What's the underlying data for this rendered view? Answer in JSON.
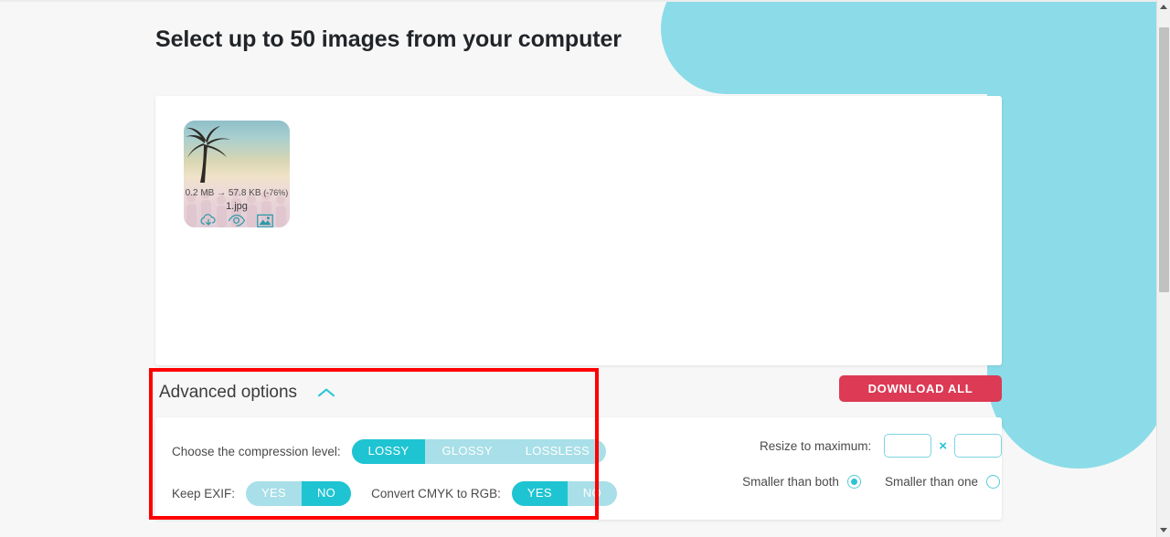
{
  "page": {
    "title": "Select up to 50 images from your computer",
    "background_color": "#f7f7f7",
    "accent_color": "#1fc4d2",
    "accent_light_color": "#8bdce8",
    "danger_color": "#dc3a55",
    "annotation_color": "#ff0000"
  },
  "upload_card": {
    "thumbnails": [
      {
        "size_before": "0.2 MB",
        "arrow": "→",
        "size_after": "57.8 KB",
        "percent": "(-76%)",
        "filename": "1.jpg",
        "actions": [
          {
            "name": "download-icon",
            "title": "Download"
          },
          {
            "name": "preview-eye-icon",
            "title": "Preview"
          },
          {
            "name": "image-compare-icon",
            "title": "Compare"
          }
        ]
      }
    ]
  },
  "download": {
    "label": "DOWNLOAD ALL"
  },
  "advanced": {
    "title": "Advanced options",
    "chevron": "chevron-up-icon",
    "compression": {
      "label": "Choose the compression level:",
      "options": [
        {
          "label": "LOSSY",
          "selected": true
        },
        {
          "label": "GLOSSY",
          "selected": false
        },
        {
          "label": "LOSSLESS",
          "selected": false
        }
      ],
      "selected": "LOSSY"
    },
    "keep_exif": {
      "label": "Keep EXIF:",
      "options": [
        {
          "label": "YES",
          "selected": false
        },
        {
          "label": "NO",
          "selected": true
        }
      ],
      "selected": "NO"
    },
    "convert_cmyk": {
      "label": "Convert CMYK to RGB:",
      "options": [
        {
          "label": "YES",
          "selected": true
        },
        {
          "label": "NO",
          "selected": false
        }
      ],
      "selected": "YES"
    },
    "resize": {
      "label": "Resize to maximum:",
      "width_value": "",
      "height_value": "",
      "separator": "×"
    },
    "resize_mode": {
      "options": [
        {
          "label": "Smaller than both",
          "selected": true
        },
        {
          "label": "Smaller than one",
          "selected": false
        }
      ],
      "selected": "Smaller than both"
    }
  },
  "scrollbar": {
    "up_arrow": "scroll-up-arrow",
    "down_arrow": "scroll-down-arrow"
  }
}
